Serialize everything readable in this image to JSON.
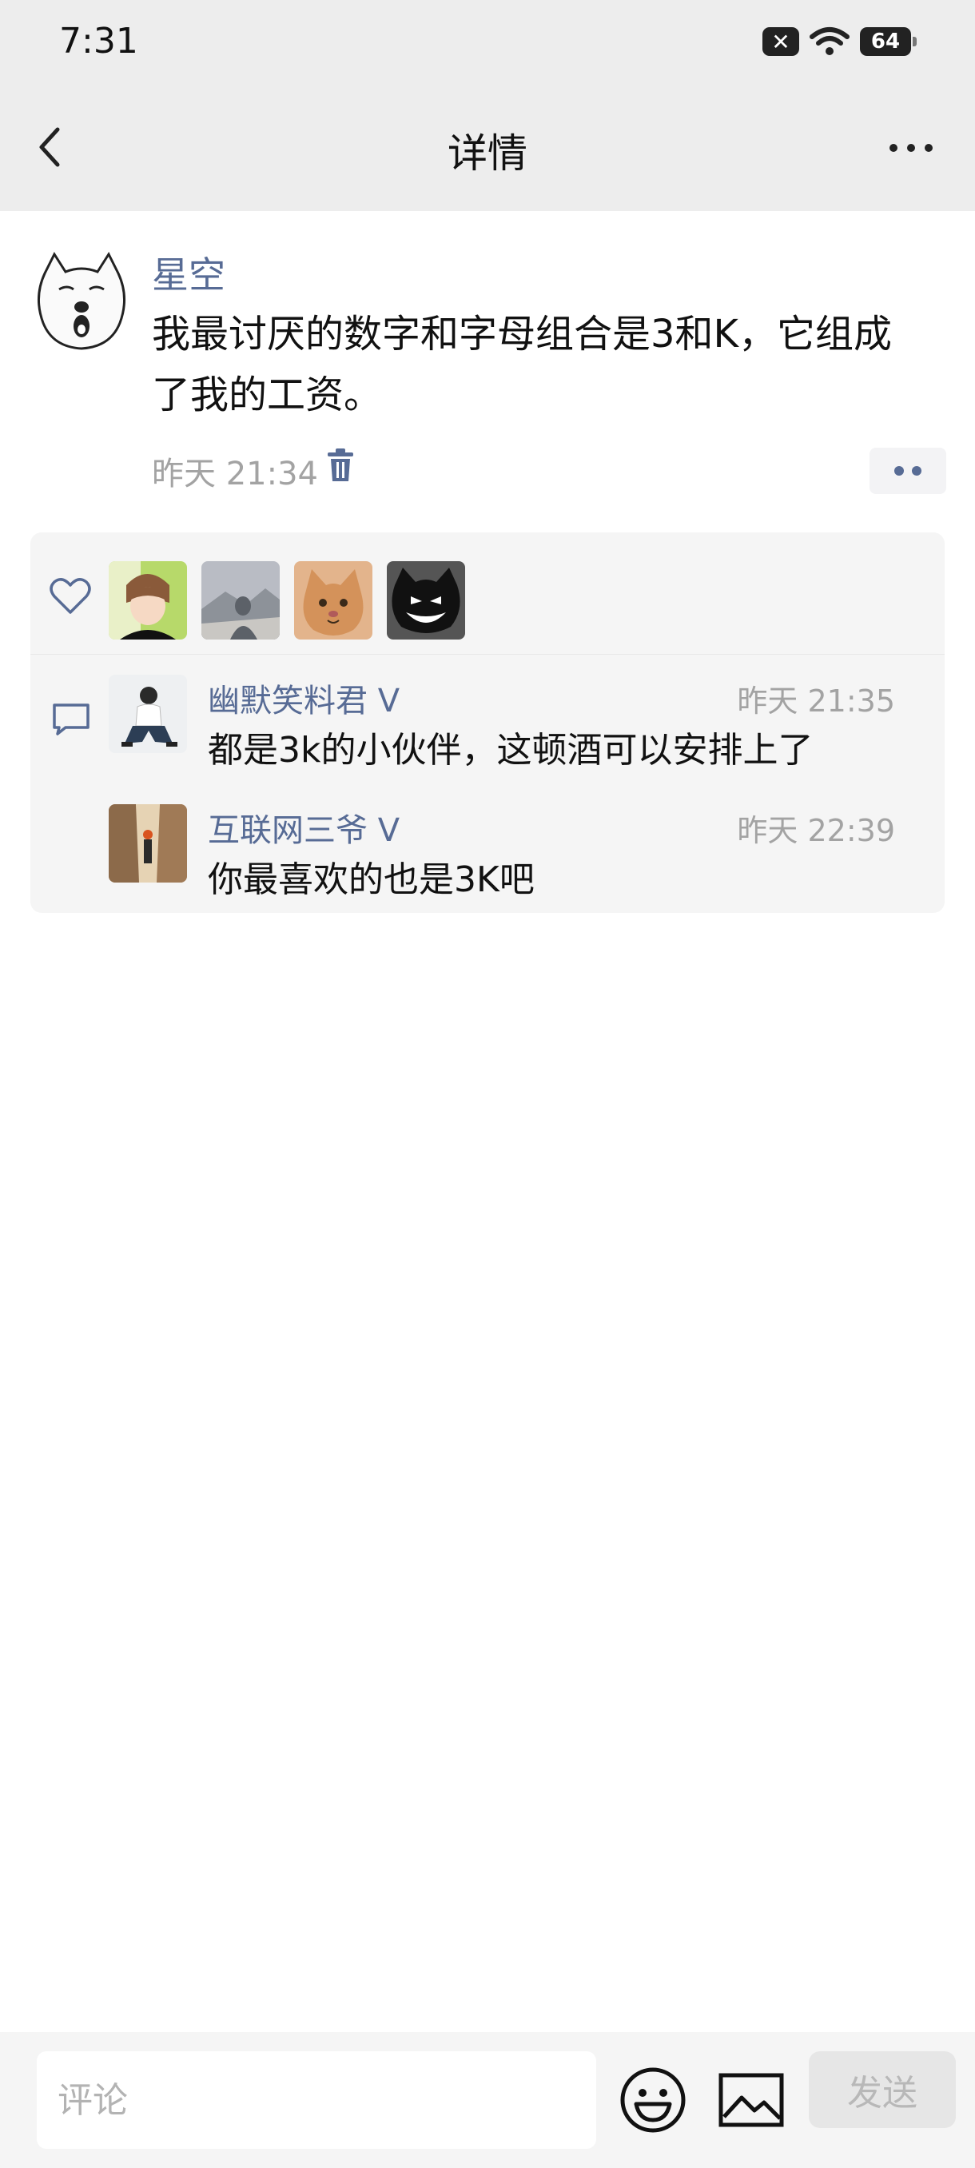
{
  "status_bar": {
    "time": "7:31",
    "battery": "64",
    "sim_badge": "✕"
  },
  "nav": {
    "title": "详情"
  },
  "post": {
    "author": "星空",
    "text": "我最讨厌的数字和字母组合是3和K，它组成了我的工资。",
    "time": "昨天 21:34"
  },
  "likes": [
    {
      "avatar": "anime-boy-avatar"
    },
    {
      "avatar": "mountain-view-avatar"
    },
    {
      "avatar": "cat-avatar"
    },
    {
      "avatar": "cartoon-grin-avatar"
    }
  ],
  "comments": [
    {
      "name": "幽默笑料君 V",
      "time": "昨天 21:35",
      "text": "都是3k的小伙伴，这顿酒可以安排上了"
    },
    {
      "name": "互联网三爷 V",
      "time": "昨天 22:39",
      "text": "你最喜欢的也是3K吧"
    }
  ],
  "bottom": {
    "placeholder": "评论",
    "send_label": "发送"
  }
}
